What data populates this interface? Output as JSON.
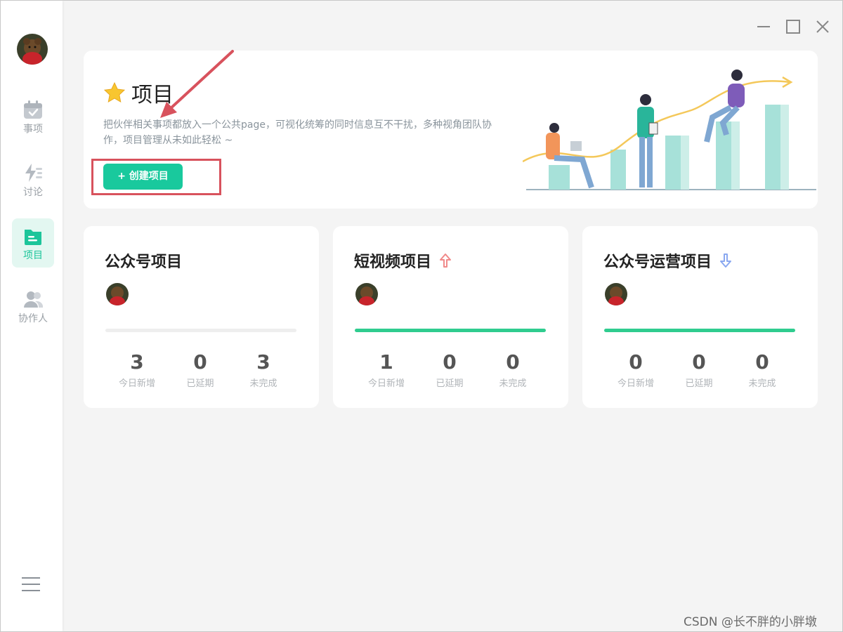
{
  "sidebar": {
    "items": [
      {
        "label": "事项",
        "icon": "calendar-check-icon",
        "active": false
      },
      {
        "label": "讨论",
        "icon": "lightning-discussion-icon",
        "active": false
      },
      {
        "label": "项目",
        "icon": "project-folder-icon",
        "active": true
      },
      {
        "label": "协作人",
        "icon": "collaborators-icon",
        "active": false
      }
    ],
    "menu_icon": "hamburger-menu-icon"
  },
  "window_controls": [
    "minimize-icon",
    "maximize-icon",
    "close-icon"
  ],
  "banner": {
    "title": "项目",
    "title_icon": "star-icon",
    "description": "把伙伴相关事项都放入一个公共page，可视化统筹的同时信息互不干扰，多种视角团队协作，项目管理从未如此轻松 ~",
    "create_button": "+ 创建项目"
  },
  "projects": [
    {
      "name": "公众号项目",
      "badge_icon": null,
      "progress": 0,
      "stats": [
        {
          "value": "3",
          "label": "今日新增"
        },
        {
          "value": "0",
          "label": "已延期"
        },
        {
          "value": "3",
          "label": "未完成"
        }
      ]
    },
    {
      "name": "短视频项目",
      "badge_icon": "trend-up-icon",
      "progress": 1,
      "stats": [
        {
          "value": "1",
          "label": "今日新增"
        },
        {
          "value": "0",
          "label": "已延期"
        },
        {
          "value": "0",
          "label": "未完成"
        }
      ]
    },
    {
      "name": "公众号运营项目",
      "badge_icon": "trend-down-icon",
      "progress": 1,
      "stats": [
        {
          "value": "0",
          "label": "今日新增"
        },
        {
          "value": "0",
          "label": "已延期"
        },
        {
          "value": "0",
          "label": "未完成"
        }
      ]
    }
  ],
  "colors": {
    "accent": "#19c99d",
    "progress": "#2fcc8f",
    "highlight": "#d8525d"
  },
  "watermark": "CSDN @长不胖的小胖墩"
}
